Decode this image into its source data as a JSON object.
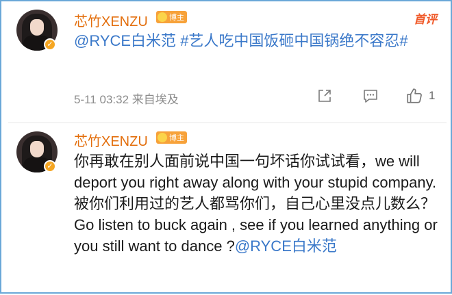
{
  "comments": [
    {
      "username": "芯竹XENZU",
      "badge": "博主",
      "corner_label": "首评",
      "mention": "@RYCE白米范",
      "hashtag": "#艺人吃中国饭砸中国锅绝不容忍#",
      "timestamp": "5-11 03:32",
      "source": "来自埃及",
      "likes": "1"
    },
    {
      "username": "芯竹XENZU",
      "badge": "博主",
      "text": "你再敢在别人面前说中国一句坏话你试试看，we will deport you right away along with your stupid company. 被你们利用过的艺人都骂你们，自己心里没点儿数么？ Go listen to buck again , see if you learned anything or you still want to dance ?",
      "mention": "@RYCE白米范"
    }
  ],
  "icons": [
    "verified-icon",
    "share-icon",
    "comment-icon",
    "like-icon"
  ],
  "colors": {
    "username": "#e36e0c",
    "link": "#3a78c9",
    "badge": "#f7a23a",
    "frame": "#6aa8d8"
  }
}
